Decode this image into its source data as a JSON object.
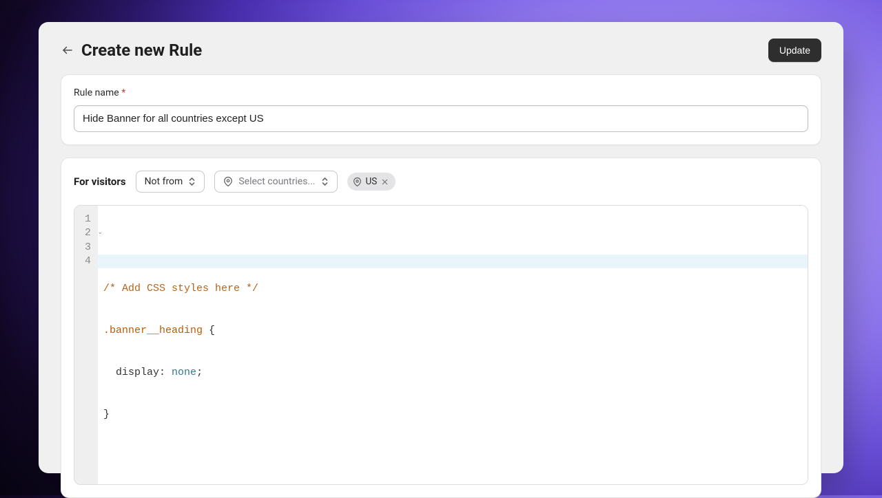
{
  "header": {
    "title": "Create new Rule",
    "update_label": "Update"
  },
  "rule_name": {
    "label": "Rule name",
    "required_mark": "*",
    "value": "Hide Banner for all countries except US"
  },
  "visitors": {
    "label": "For visitors",
    "condition": "Not from",
    "country_placeholder": "Select countries...",
    "selected_countries": [
      "US"
    ]
  },
  "editor": {
    "line_numbers": [
      "1",
      "2",
      "3",
      "4"
    ],
    "code": {
      "l1_comment": "/* Add CSS styles here */",
      "l2_selector": ".banner__heading",
      "l2_brace": " {",
      "l3_indent": "  ",
      "l3_prop": "display",
      "l3_colon": ": ",
      "l3_val": "none",
      "l3_semi": ";",
      "l4_brace": "}"
    }
  }
}
